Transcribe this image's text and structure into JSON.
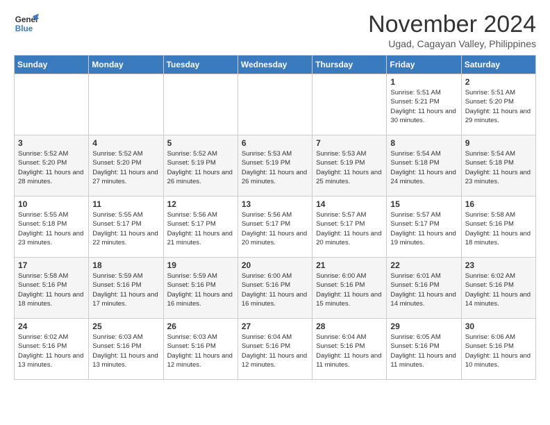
{
  "header": {
    "logo_line1": "General",
    "logo_line2": "Blue",
    "month_title": "November 2024",
    "location": "Ugad, Cagayan Valley, Philippines"
  },
  "weekdays": [
    "Sunday",
    "Monday",
    "Tuesday",
    "Wednesday",
    "Thursday",
    "Friday",
    "Saturday"
  ],
  "weeks": [
    [
      {
        "day": "",
        "info": ""
      },
      {
        "day": "",
        "info": ""
      },
      {
        "day": "",
        "info": ""
      },
      {
        "day": "",
        "info": ""
      },
      {
        "day": "",
        "info": ""
      },
      {
        "day": "1",
        "info": "Sunrise: 5:51 AM\nSunset: 5:21 PM\nDaylight: 11 hours and 30 minutes."
      },
      {
        "day": "2",
        "info": "Sunrise: 5:51 AM\nSunset: 5:20 PM\nDaylight: 11 hours and 29 minutes."
      }
    ],
    [
      {
        "day": "3",
        "info": "Sunrise: 5:52 AM\nSunset: 5:20 PM\nDaylight: 11 hours and 28 minutes."
      },
      {
        "day": "4",
        "info": "Sunrise: 5:52 AM\nSunset: 5:20 PM\nDaylight: 11 hours and 27 minutes."
      },
      {
        "day": "5",
        "info": "Sunrise: 5:52 AM\nSunset: 5:19 PM\nDaylight: 11 hours and 26 minutes."
      },
      {
        "day": "6",
        "info": "Sunrise: 5:53 AM\nSunset: 5:19 PM\nDaylight: 11 hours and 26 minutes."
      },
      {
        "day": "7",
        "info": "Sunrise: 5:53 AM\nSunset: 5:19 PM\nDaylight: 11 hours and 25 minutes."
      },
      {
        "day": "8",
        "info": "Sunrise: 5:54 AM\nSunset: 5:18 PM\nDaylight: 11 hours and 24 minutes."
      },
      {
        "day": "9",
        "info": "Sunrise: 5:54 AM\nSunset: 5:18 PM\nDaylight: 11 hours and 23 minutes."
      }
    ],
    [
      {
        "day": "10",
        "info": "Sunrise: 5:55 AM\nSunset: 5:18 PM\nDaylight: 11 hours and 23 minutes."
      },
      {
        "day": "11",
        "info": "Sunrise: 5:55 AM\nSunset: 5:17 PM\nDaylight: 11 hours and 22 minutes."
      },
      {
        "day": "12",
        "info": "Sunrise: 5:56 AM\nSunset: 5:17 PM\nDaylight: 11 hours and 21 minutes."
      },
      {
        "day": "13",
        "info": "Sunrise: 5:56 AM\nSunset: 5:17 PM\nDaylight: 11 hours and 20 minutes."
      },
      {
        "day": "14",
        "info": "Sunrise: 5:57 AM\nSunset: 5:17 PM\nDaylight: 11 hours and 20 minutes."
      },
      {
        "day": "15",
        "info": "Sunrise: 5:57 AM\nSunset: 5:17 PM\nDaylight: 11 hours and 19 minutes."
      },
      {
        "day": "16",
        "info": "Sunrise: 5:58 AM\nSunset: 5:16 PM\nDaylight: 11 hours and 18 minutes."
      }
    ],
    [
      {
        "day": "17",
        "info": "Sunrise: 5:58 AM\nSunset: 5:16 PM\nDaylight: 11 hours and 18 minutes."
      },
      {
        "day": "18",
        "info": "Sunrise: 5:59 AM\nSunset: 5:16 PM\nDaylight: 11 hours and 17 minutes."
      },
      {
        "day": "19",
        "info": "Sunrise: 5:59 AM\nSunset: 5:16 PM\nDaylight: 11 hours and 16 minutes."
      },
      {
        "day": "20",
        "info": "Sunrise: 6:00 AM\nSunset: 5:16 PM\nDaylight: 11 hours and 16 minutes."
      },
      {
        "day": "21",
        "info": "Sunrise: 6:00 AM\nSunset: 5:16 PM\nDaylight: 11 hours and 15 minutes."
      },
      {
        "day": "22",
        "info": "Sunrise: 6:01 AM\nSunset: 5:16 PM\nDaylight: 11 hours and 14 minutes."
      },
      {
        "day": "23",
        "info": "Sunrise: 6:02 AM\nSunset: 5:16 PM\nDaylight: 11 hours and 14 minutes."
      }
    ],
    [
      {
        "day": "24",
        "info": "Sunrise: 6:02 AM\nSunset: 5:16 PM\nDaylight: 11 hours and 13 minutes."
      },
      {
        "day": "25",
        "info": "Sunrise: 6:03 AM\nSunset: 5:16 PM\nDaylight: 11 hours and 13 minutes."
      },
      {
        "day": "26",
        "info": "Sunrise: 6:03 AM\nSunset: 5:16 PM\nDaylight: 11 hours and 12 minutes."
      },
      {
        "day": "27",
        "info": "Sunrise: 6:04 AM\nSunset: 5:16 PM\nDaylight: 11 hours and 12 minutes."
      },
      {
        "day": "28",
        "info": "Sunrise: 6:04 AM\nSunset: 5:16 PM\nDaylight: 11 hours and 11 minutes."
      },
      {
        "day": "29",
        "info": "Sunrise: 6:05 AM\nSunset: 5:16 PM\nDaylight: 11 hours and 11 minutes."
      },
      {
        "day": "30",
        "info": "Sunrise: 6:06 AM\nSunset: 5:16 PM\nDaylight: 11 hours and 10 minutes."
      }
    ]
  ]
}
